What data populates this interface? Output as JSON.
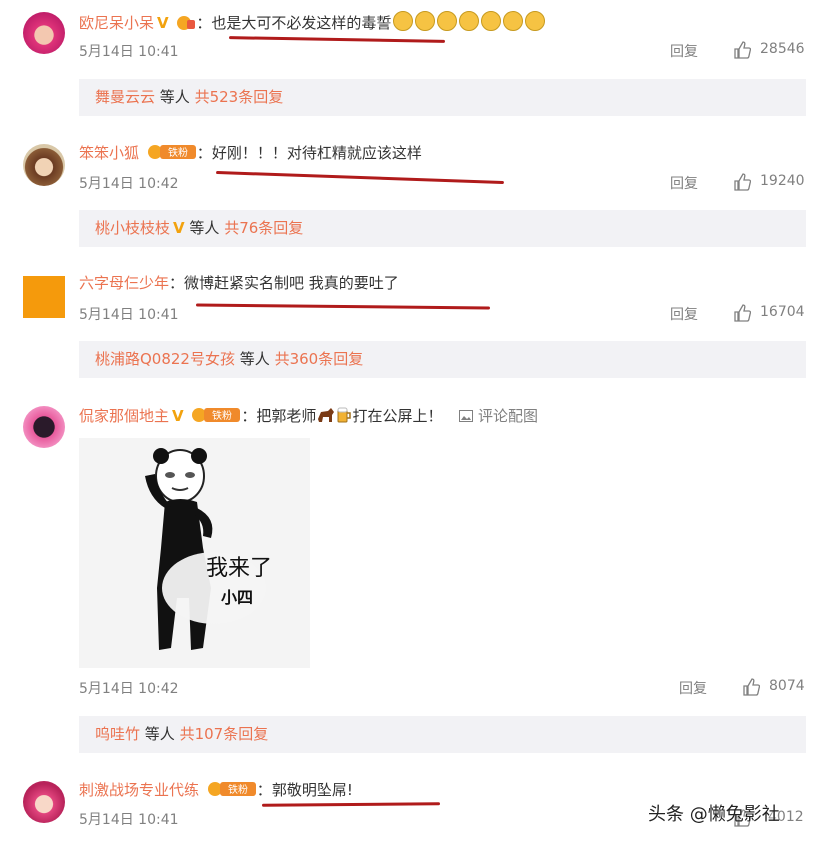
{
  "comments": [
    {
      "user": "欧尼呆小呆",
      "colon": "：",
      "text": "也是大可不必发这样的毒誓",
      "time": "5月14日 10:41",
      "reply_label": "回复",
      "likes": "28546",
      "replies": {
        "names": "舞曼云云",
        "suffix": "等人",
        "count": "共523条回复"
      }
    },
    {
      "user": "笨笨小狐",
      "colon": "：",
      "text": "好刚！！！对待杠精就应该这样",
      "time": "5月14日 10:42",
      "reply_label": "回复",
      "likes": "19240",
      "replies": {
        "names": "桃小枝枝枝",
        "suffix": "等人",
        "count": "共76条回复"
      }
    },
    {
      "user": "六字母仨少年",
      "colon": "：",
      "text": "微博赶紧实名制吧  我真的要吐了",
      "time": "5月14日 10:41",
      "reply_label": "回复",
      "likes": "16704",
      "replies": {
        "names": "桃浦路Q0822号女孩",
        "suffix": "等人",
        "count": "共360条回复"
      }
    },
    {
      "user": "侃家那個地主",
      "colon": "：",
      "text_before": "把郭老师",
      "text_after": "打在公屏上！",
      "pic_label": "评论配图",
      "image_text_main": "我来了",
      "image_text_sub": "小四",
      "time": "5月14日 10:42",
      "reply_label": "回复",
      "likes": "8074",
      "replies": {
        "names": "呜哇竹",
        "suffix": "等人",
        "count": "共107条回复"
      }
    },
    {
      "user": "刺激战场专业代练",
      "colon": "：",
      "text": "郭敬明坠屌!",
      "time": "5月14日 10:41",
      "likes": "4012"
    }
  ],
  "badges": {
    "fan_label": "铁粉",
    "v_label": "V"
  },
  "watermark": "头条 @懒兔影社",
  "colors": {
    "username": "#eb7350",
    "underline": "#b01b1b",
    "reply_bg": "#f2f2f5",
    "meta": "#808080"
  }
}
